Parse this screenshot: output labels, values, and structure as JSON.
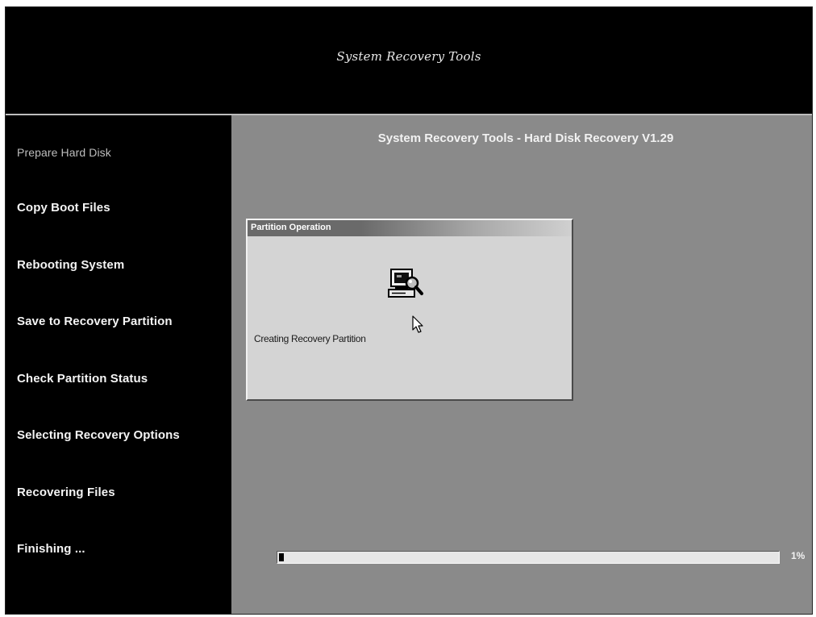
{
  "header": {
    "title": "System Recovery Tools"
  },
  "sidebar": {
    "steps": [
      {
        "label": "Prepare Hard Disk",
        "active": true
      },
      {
        "label": "Copy Boot Files",
        "active": false
      },
      {
        "label": "Rebooting System",
        "active": false
      },
      {
        "label": "Save to Recovery Partition",
        "active": false
      },
      {
        "label": "Check Partition Status",
        "active": false
      },
      {
        "label": "Selecting Recovery Options",
        "active": false
      },
      {
        "label": "Recovering Files",
        "active": false
      },
      {
        "label": "Finishing ...",
        "active": false
      }
    ]
  },
  "main": {
    "title": "System Recovery Tools - Hard Disk Recovery V1.29"
  },
  "dialog": {
    "title": "Partition Operation",
    "icon": "computer-search-icon",
    "status": "Creating Recovery Partition"
  },
  "cursor": {
    "icon": "mouse-pointer-icon"
  },
  "progress": {
    "percent": 1,
    "label": "1%"
  },
  "colors": {
    "background": "#000000",
    "main_panel": "#8a8a8a",
    "dialog_face": "#d4d4d4",
    "progress_fill": "#000000"
  }
}
